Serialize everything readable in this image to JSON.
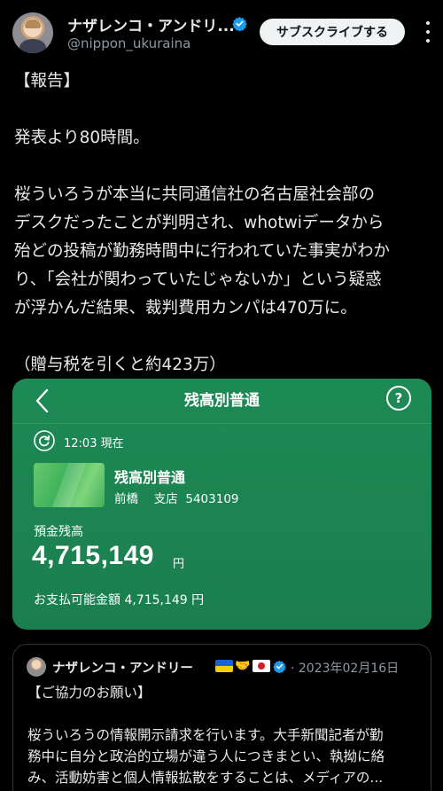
{
  "author": {
    "display_name": "ナザレンコ・アンドリ...",
    "handle": "@nippon_ukuraina"
  },
  "subscribe_label": "サブスクライブする",
  "tweet": {
    "lines": [
      "【報告】",
      "",
      "発表より80時間。",
      "",
      "桜ういろうが本当に共同通信社の名古屋社会部の",
      "デスクだったことが判明され、whotwiデータから",
      "殆どの投稿が勤務時間中に行われていた事実がわか",
      "り、「会社が関わっていたじゃないか」という疑惑",
      "が浮かんだ結果、裁判費用カンパは470万に。",
      "",
      "（贈与税を引くと約423万）"
    ]
  },
  "bank": {
    "title": "残高別普通",
    "help_label": "?",
    "update_time": "12:03 現在",
    "account_name": "残高別普通",
    "account_detail": "前橋　 支店  5403109",
    "balance_label": "預金残高",
    "balance_value": "4,715,149",
    "balance_unit": "円",
    "available": "お支払可能金額 4,715,149 円"
  },
  "quote": {
    "display_name": "ナザレンコ・アンドリー",
    "date": "· 2023年02月16日",
    "lines": [
      "【ご協力のお願い】",
      "",
      "桜ういろうの情報開示請求を行います。大手新聞記者が勤",
      "務中に自分と政治的立場が違う人につきまとい、執拗に絡",
      "み、活動妨害と個人情報拡散をすることは、メディアの..."
    ]
  },
  "colors": {
    "background": "#000000",
    "bank_green": "#1d8a55",
    "verified_blue": "#1d9bf0",
    "text_secondary": "#8b98a5"
  },
  "icons": [
    "avatar",
    "verified-badge-icon",
    "more-icon",
    "back-chevron-icon",
    "help-icon",
    "refresh-icon",
    "ukraine-flag-icon",
    "handshake-icon",
    "japan-flag-icon"
  ]
}
